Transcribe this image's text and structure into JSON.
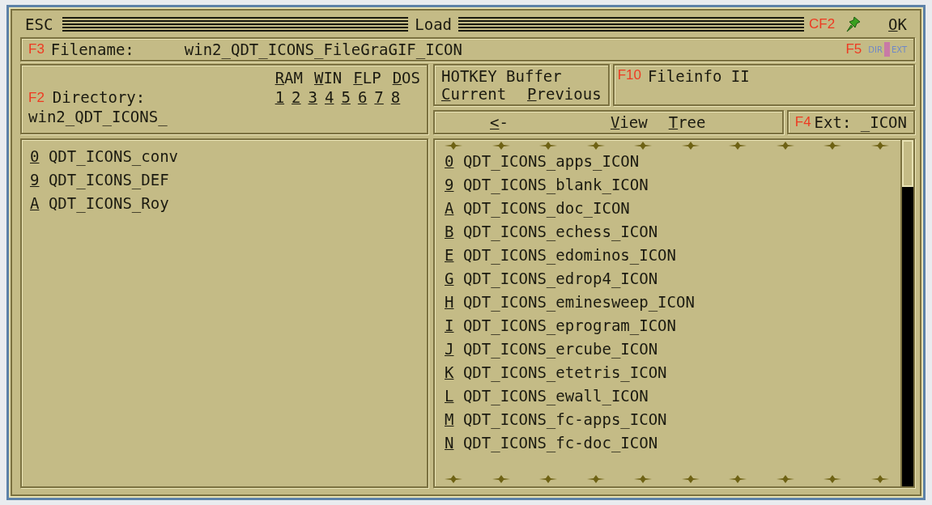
{
  "title_bar": {
    "escape": "ESC",
    "title": "Load",
    "hotkey": "CF2",
    "ok": "OK"
  },
  "filename": {
    "key": "F3",
    "label": "Filename:",
    "value": "win2_QDT_ICONS_FileGraGIF_ICON",
    "toggle_key": "F5",
    "toggle_left": "DIR",
    "toggle_right": "EXT",
    "toggle_on": true
  },
  "directory": {
    "key": "F2",
    "label": "Directory:",
    "path": "win2_QDT_ICONS_",
    "drives": [
      "RAM",
      "WIN",
      "FLP",
      "DOS"
    ],
    "slots": [
      "1",
      "2",
      "3",
      "4",
      "5",
      "6",
      "7",
      "8"
    ]
  },
  "hotkey_buffer": {
    "title": "HOTKEY Buffer",
    "buttons": [
      "Current",
      "Previous"
    ]
  },
  "fileinfo": {
    "key": "F10",
    "label": "Fileinfo II"
  },
  "nav": {
    "back": "<-",
    "view": "View",
    "tree": "Tree",
    "ext_key": "F4",
    "ext_label": "Ext: _ICON"
  },
  "directories": [
    {
      "key": "0",
      "name": "QDT_ICONS_conv"
    },
    {
      "key": "9",
      "name": "QDT_ICONS_DEF"
    },
    {
      "key": "A",
      "name": "QDT_ICONS_Roy"
    }
  ],
  "files": [
    {
      "key": "0",
      "name": "QDT_ICONS_apps_ICON"
    },
    {
      "key": "9",
      "name": "QDT_ICONS_blank_ICON"
    },
    {
      "key": "A",
      "name": "QDT_ICONS_doc_ICON"
    },
    {
      "key": "B",
      "name": "QDT_ICONS_echess_ICON"
    },
    {
      "key": "E",
      "name": "QDT_ICONS_edominos_ICON"
    },
    {
      "key": "G",
      "name": "QDT_ICONS_edrop4_ICON"
    },
    {
      "key": "H",
      "name": "QDT_ICONS_eminesweep_ICON"
    },
    {
      "key": "I",
      "name": "QDT_ICONS_eprogram_ICON"
    },
    {
      "key": "J",
      "name": "QDT_ICONS_ercube_ICON"
    },
    {
      "key": "K",
      "name": "QDT_ICONS_etetris_ICON"
    },
    {
      "key": "L",
      "name": "QDT_ICONS_ewall_ICON"
    },
    {
      "key": "M",
      "name": "QDT_ICONS_fc-apps_ICON"
    },
    {
      "key": "N",
      "name": "QDT_ICONS_fc-doc_ICON"
    }
  ]
}
